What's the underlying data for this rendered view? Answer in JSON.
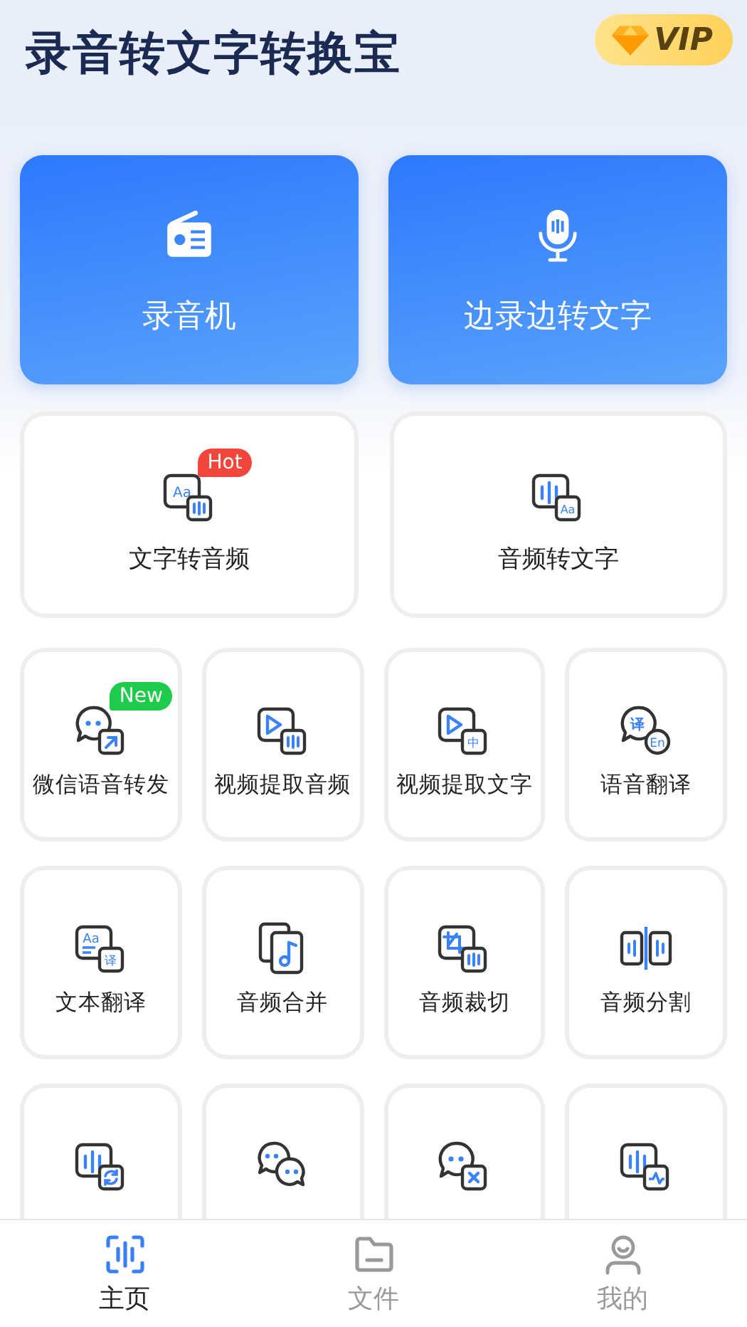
{
  "header": {
    "title": "录音转文字转换宝",
    "vip_badge": "VIP"
  },
  "main_actions": [
    {
      "label": "录音机"
    },
    {
      "label": "边录边转文字"
    }
  ],
  "features": [
    {
      "label": "文字转音频",
      "badge": {
        "text": "Hot",
        "color": "#f2463a"
      },
      "main_text": "Aa"
    },
    {
      "label": "音频转文字",
      "sub_text": "Aa"
    }
  ],
  "tools": [
    {
      "label": "微信语音转发",
      "badge": {
        "text": "New",
        "color": "#1fcb4a"
      }
    },
    {
      "label": "视频提取音频"
    },
    {
      "label": "视频提取文字",
      "sub_text": "中"
    },
    {
      "label": "语音翻译",
      "main_text": "译",
      "sub_text": "En"
    },
    {
      "label": "文本翻译",
      "main_text": "Aa",
      "sub_text": "译"
    },
    {
      "label": "音频合并"
    },
    {
      "label": "音频裁切"
    },
    {
      "label": "音频分割"
    },
    {
      "kind": "tool"
    },
    {
      "kind": "tool"
    },
    {
      "kind": "tool"
    },
    {
      "kind": "tool"
    }
  ],
  "tab_bar": [
    {
      "label": "主页",
      "selected": true
    },
    {
      "label": "文件",
      "selected": false
    },
    {
      "label": "我的",
      "selected": false
    }
  ]
}
